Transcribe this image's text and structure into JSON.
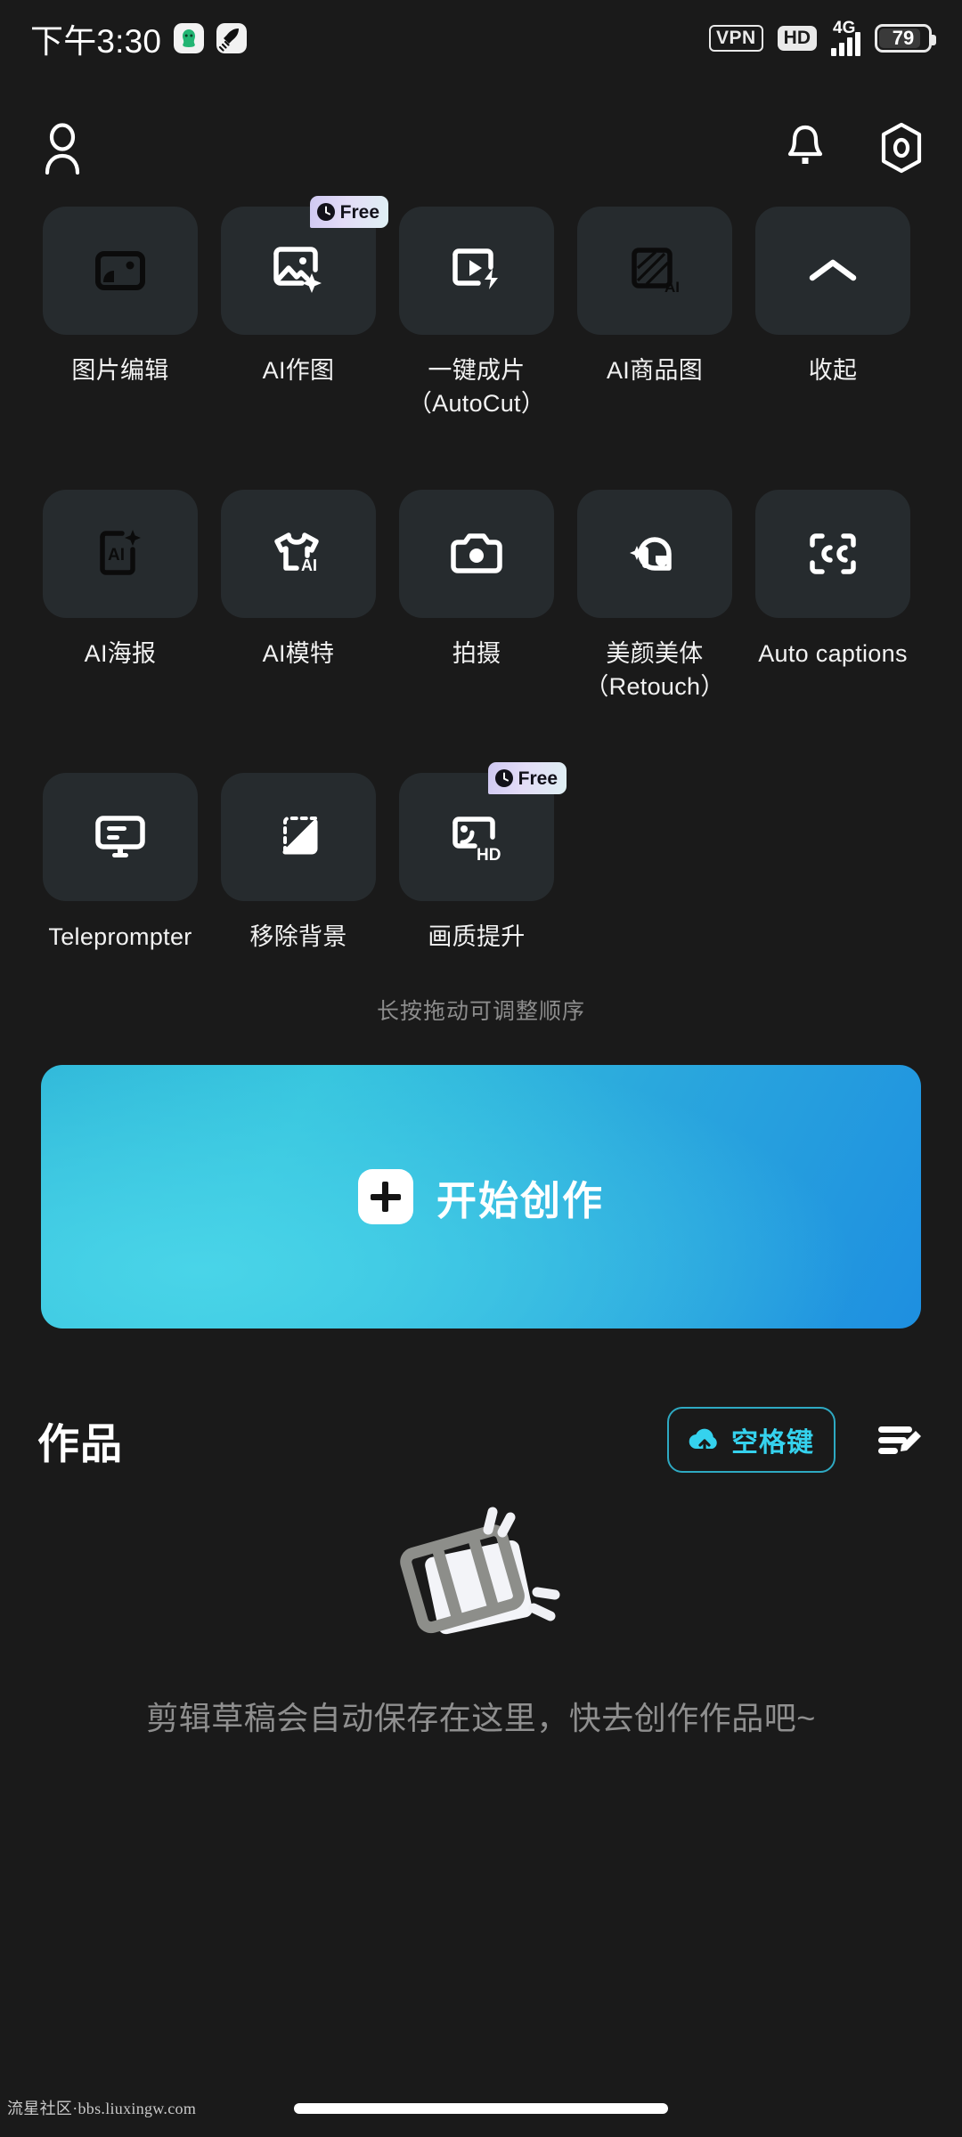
{
  "status_bar": {
    "time": "下午3:30",
    "app_icon_1": "green-ghost-app-icon",
    "app_icon_2": "rocket-app-icon",
    "vpn_label": "VPN",
    "hd_label": "HD",
    "network_label": "4G",
    "signal_bars": 4,
    "battery_percent": "79"
  },
  "header": {
    "profile_icon": "user-avatar-icon",
    "notification_icon": "bell-icon",
    "settings_icon": "hexagon-settings-icon"
  },
  "tools": {
    "hint": "长按拖动可调整顺序",
    "badge_label": "Free",
    "rows": [
      [
        {
          "label": "图片编辑",
          "icon": "image-edit-icon",
          "badge": false,
          "dark_icon": true
        },
        {
          "label": "AI作图",
          "icon": "ai-image-generate-icon",
          "badge": true,
          "dark_icon": false
        },
        {
          "label": "一键成片\n（AutoCut）",
          "icon": "autocut-icon",
          "badge": false,
          "dark_icon": false
        },
        {
          "label": "AI商品图",
          "icon": "ai-product-image-icon",
          "badge": false,
          "dark_icon": true
        },
        {
          "label": "收起",
          "icon": "chevron-up-icon",
          "badge": false,
          "dark_icon": false
        }
      ],
      [
        {
          "label": "AI海报",
          "icon": "ai-poster-icon",
          "badge": false,
          "dark_icon": true
        },
        {
          "label": "AI模特",
          "icon": "ai-model-tshirt-icon",
          "badge": false,
          "dark_icon": false
        },
        {
          "label": "拍摄",
          "icon": "camera-icon",
          "badge": false,
          "dark_icon": false
        },
        {
          "label": "美颜美体\n（Retouch）",
          "icon": "retouch-icon",
          "badge": false,
          "dark_icon": false
        },
        {
          "label": "Auto captions",
          "icon": "closed-caption-icon",
          "badge": false,
          "dark_icon": false
        }
      ],
      [
        {
          "label": "Teleprompter",
          "icon": "teleprompter-icon",
          "badge": false,
          "dark_icon": false
        },
        {
          "label": "移除背景",
          "icon": "remove-background-icon",
          "badge": false,
          "dark_icon": false
        },
        {
          "label": "画质提升",
          "icon": "hd-enhance-icon",
          "badge": true,
          "dark_icon": false
        }
      ]
    ]
  },
  "create_button": {
    "label": "开始创作",
    "icon": "plus-icon",
    "gradient_from": "#35c3dd",
    "gradient_to": "#1e8fe0"
  },
  "works": {
    "title": "作品",
    "cloud_button_label": "空格键",
    "cloud_button_icon": "cloud-upload-icon",
    "cloud_accent": "#35d2ee",
    "manage_icon": "edit-list-icon"
  },
  "empty_state": {
    "illustration": "film-clip-icon",
    "text": "剪辑草稿会自动保存在这里，快去创作作品吧~"
  },
  "watermark": {
    "text": "流星社区·bbs.liuxingw.com"
  }
}
